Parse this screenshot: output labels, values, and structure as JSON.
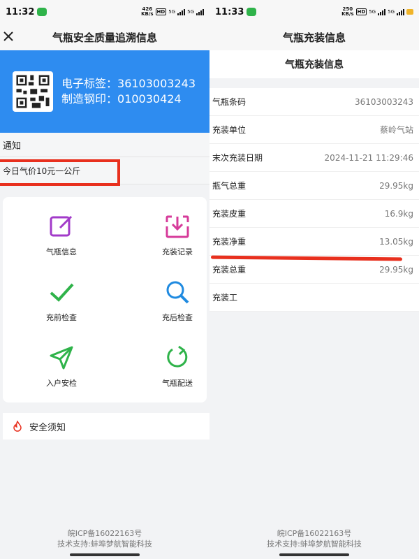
{
  "left": {
    "status": {
      "time": "11:32",
      "speed_value": "426",
      "speed_unit": "KB/s",
      "net": "5G"
    },
    "title": "气瓶安全质量追溯信息",
    "banner": {
      "tag_label": "电子标签：",
      "tag_value": "36103003243",
      "steel_label": "制造钢印：",
      "steel_value": "010030424"
    },
    "notice_title": "通知",
    "notice_text": "今日气价10元一公斤",
    "menu": [
      {
        "label": "气瓶信息",
        "icon": "edit-icon"
      },
      {
        "label": "充装记录",
        "icon": "download-icon"
      },
      {
        "label": "充前检查",
        "icon": "check-icon"
      },
      {
        "label": "充后检查",
        "icon": "search-icon"
      },
      {
        "label": "入户安检",
        "icon": "send-icon"
      },
      {
        "label": "气瓶配送",
        "icon": "refresh-icon"
      }
    ],
    "safety_label": "安全须知",
    "footer_icp": "皖ICP备16022163号",
    "footer_support": "技术支持:蚌埠梦航智能科技"
  },
  "right": {
    "status": {
      "time": "11:33",
      "speed_value": "250",
      "speed_unit": "KB/s",
      "net": "5G"
    },
    "title": "气瓶充装信息",
    "subtitle": "气瓶充装信息",
    "rows": [
      {
        "label": "气瓶条码",
        "value": "36103003243"
      },
      {
        "label": "充装单位",
        "value": "蔡岭气站"
      },
      {
        "label": "末次充装日期",
        "value": "2024-11-21 11:29:46"
      },
      {
        "label": "瓶气总重",
        "value": "29.95kg"
      },
      {
        "label": "充装皮重",
        "value": "16.9kg"
      },
      {
        "label": "充装净重",
        "value": "13.05kg"
      },
      {
        "label": "充装总重",
        "value": "29.95kg"
      },
      {
        "label": "充装工",
        "value": ""
      }
    ],
    "footer_icp": "皖ICP备16022163号",
    "footer_support": "技术支持:蚌埠梦航智能科技"
  },
  "colors": {
    "banner_blue": "#2e8cf0",
    "annotation_red": "#e8301e",
    "icon_purple": "#a23ac9",
    "icon_pink": "#d63b9a",
    "icon_green": "#2fb34a",
    "icon_blue": "#1f8ae0"
  }
}
